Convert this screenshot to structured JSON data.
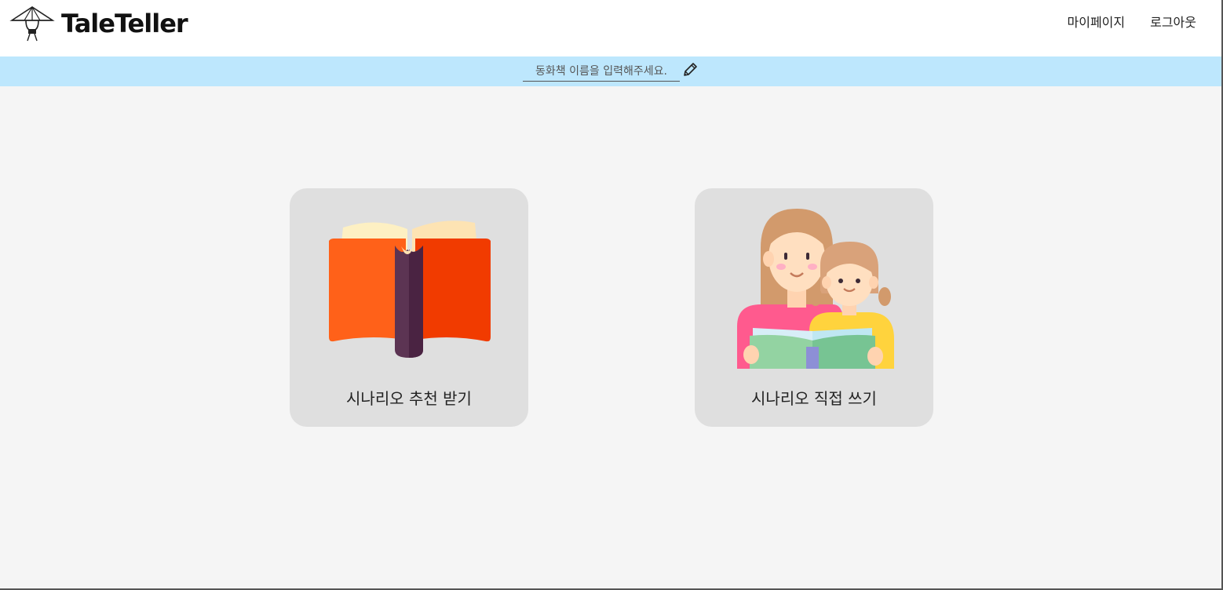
{
  "app": {
    "name": "TaleTeller",
    "logo_icon": "hat-person-icon"
  },
  "nav": {
    "mypage_label": "마이페이지",
    "logout_label": "로그아웃"
  },
  "title_bar": {
    "placeholder": "동화책 이름을 입력해주세요.",
    "value": "",
    "edit_icon": "pencil-icon",
    "background": "#bde7fd"
  },
  "cards": [
    {
      "label": "시나리오 추천 받기",
      "icon": "open-book-icon"
    },
    {
      "label": "시나리오 직접 쓰기",
      "icon": "mother-child-reading-icon"
    }
  ],
  "colors": {
    "page_background": "#f5f5f5",
    "card_background": "#dfdfdf"
  }
}
